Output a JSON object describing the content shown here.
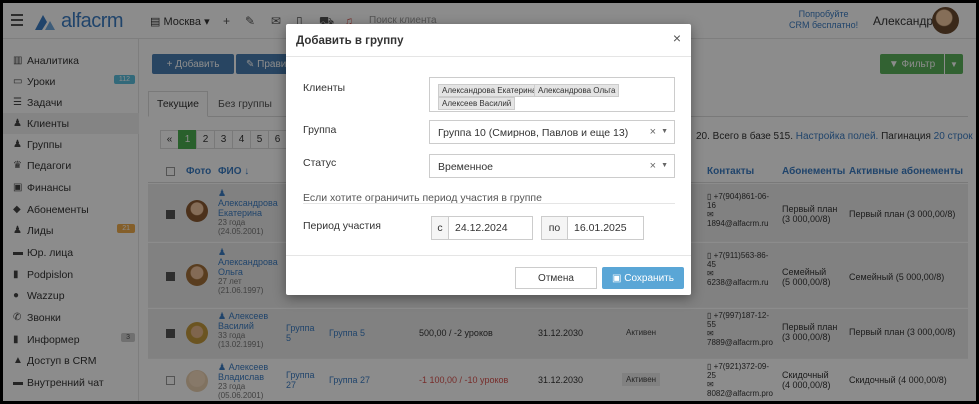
{
  "brand": {
    "name": "alfacrm"
  },
  "topbar": {
    "branch": "Москва",
    "search_placeholder": "Поиск клиента",
    "try_line1": "Попробуйте",
    "try_line2": "CRM бесплатно!",
    "user_name": "Александра"
  },
  "sidebar": {
    "items": [
      {
        "label": "Аналитика",
        "icon": "chart-icon"
      },
      {
        "label": "Уроки",
        "icon": "lessons-icon",
        "badge": "112"
      },
      {
        "label": "Задачи",
        "icon": "tasks-icon"
      },
      {
        "label": "Клиенты",
        "icon": "user-icon"
      },
      {
        "label": "Группы",
        "icon": "users-icon"
      },
      {
        "label": "Педагоги",
        "icon": "graduation-icon"
      },
      {
        "label": "Финансы",
        "icon": "money-icon"
      },
      {
        "label": "Абонементы",
        "icon": "tag-icon"
      },
      {
        "label": "Лиды",
        "icon": "leads-icon",
        "badge": "21"
      },
      {
        "label": "Юр. лица",
        "icon": "briefcase-icon"
      },
      {
        "label": "Podpislon",
        "icon": "doc-icon"
      },
      {
        "label": "Wazzup",
        "icon": "chat-icon"
      },
      {
        "label": "Звонки",
        "icon": "phone-icon"
      },
      {
        "label": "Информер",
        "icon": "bookmark-icon",
        "badge": "3"
      },
      {
        "label": "Доступ в CRM",
        "icon": "lock-icon"
      },
      {
        "label": "Внутренний чат",
        "icon": "message-icon"
      }
    ]
  },
  "toolbar": {
    "add_label": "+ Добавить",
    "prav_label": "✎ Прави",
    "filter_label": "▼ Фильтр"
  },
  "tabs": [
    "Текущие",
    "Без группы"
  ],
  "pagination": {
    "pages": [
      "«",
      "1",
      "2",
      "3",
      "4",
      "5",
      "6"
    ],
    "info_prefix": "20. Всего в базе 515.",
    "settings_link": "Настройка полей.",
    "pag_label": "Пагинация",
    "pag_link": "20 строк"
  },
  "table": {
    "headers": {
      "photo": "Фото",
      "fio": "ФИО ↓",
      "contacts": "Контакты",
      "subs": "Абонементы",
      "active_subs": "Активные абонементы"
    },
    "rows": [
      {
        "name1": "Александрова",
        "name2": "Екатерина",
        "age": "23 года",
        "dob": "(24.05.2001)",
        "group": "",
        "balance": "",
        "until": "",
        "status": "",
        "phone1": "+7(904)861-06-",
        "phone2": "16",
        "email": "1894@alfacrm.ru",
        "sub1": "Первый план",
        "sub2": "(3 000,00/8)",
        "active": "Первый план (3 000,00/8)"
      },
      {
        "name1": "Александрова",
        "name2": "Ольга",
        "age": "27 лет",
        "dob": "(21.06.1997)",
        "group": "",
        "balance": "",
        "until": "",
        "status": "",
        "phone1": "+7(911)563-86-",
        "phone2": "45",
        "email": "6238@alfacrm.ru",
        "sub1": "Семейный",
        "sub2": "(5 000,00/8)",
        "active": "Семейный (5 000,00/8)"
      },
      {
        "name1": "Алексеев",
        "name2": "Василий",
        "age": "33 года",
        "dob": "(13.02.1991)",
        "group_short1": "Группа",
        "group_short2": "5",
        "group": "Группа 5",
        "balance": "500,00 / -2 уроков",
        "until": "31.12.2030",
        "status": "Активен",
        "phone1": "+7(997)187-12-",
        "phone2": "55",
        "email": "7889@alfacrm.pro",
        "sub1": "Первый план",
        "sub2": "(3 000,00/8)",
        "active": "Первый план (3 000,00/8)"
      },
      {
        "name1": "Алексеев",
        "name2": "Владислав",
        "age": "23 года",
        "dob": "(05.06.2001)",
        "group_short1": "Группа",
        "group_short2": "27",
        "group": "Группа 27",
        "balance": "-1 100,00 / -10 уроков",
        "until": "31.12.2030",
        "status": "Активен",
        "phone1": "+7(921)372-09-",
        "phone2": "25",
        "email": "8082@alfacrm.pro",
        "sub1": "Скидочный",
        "sub2": "(4 000,00/8)",
        "active": "Скидочный (4 000,00/8)"
      }
    ]
  },
  "modal": {
    "title": "Добавить в группу",
    "close": "×",
    "clients_label": "Клиенты",
    "clients": [
      "Александрова Екатерина",
      "Александрова Ольга",
      "Алексеев Василий"
    ],
    "group_label": "Группа",
    "group_value": "Группа 10 (Смирнов, Павлов и еще 13)",
    "status_label": "Статус",
    "status_value": "Временное",
    "hint": "Если хотите ограничить период участия в группе",
    "period_label": "Период участия",
    "from_label": "с",
    "from_value": "24.12.2024",
    "to_label": "по",
    "to_value": "16.01.2025",
    "cancel_label": "Отмена",
    "save_label": "Сохранить"
  },
  "colors": {
    "brand": "#3b7dc4",
    "primary_button": "#4a7fb3",
    "success": "#5cb35c",
    "save": "#5aa6d6",
    "negative": "#d9534f"
  }
}
